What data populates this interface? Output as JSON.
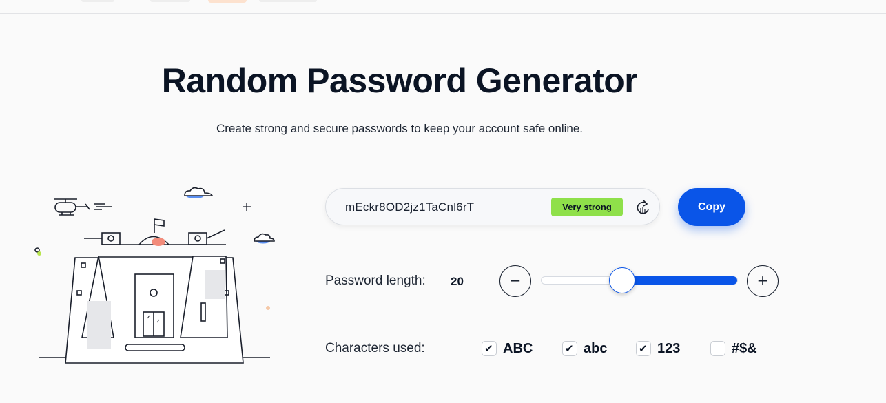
{
  "header": {
    "title": "Random Password Generator",
    "subtitle": "Create strong and secure passwords to keep your account safe online."
  },
  "password": {
    "value": "mEckr8OD2jz1TaCnl6rT",
    "strength": "Very strong",
    "copy_label": "Copy"
  },
  "length": {
    "label": "Password length:",
    "value": "20",
    "slider_fraction": 0.4,
    "minus_symbol": "−",
    "plus_symbol": "+"
  },
  "characters": {
    "label": "Characters used:",
    "options": [
      {
        "label": "ABC",
        "checked": true
      },
      {
        "label": "abc",
        "checked": true
      },
      {
        "label": "123",
        "checked": true
      },
      {
        "label": "#$&",
        "checked": false
      }
    ]
  },
  "colors": {
    "accent": "#0a55e8",
    "strength_badge": "#8fe04a",
    "text_dark": "#0b1424"
  },
  "icons": [
    "refresh-icon",
    "checkmark-icon"
  ]
}
